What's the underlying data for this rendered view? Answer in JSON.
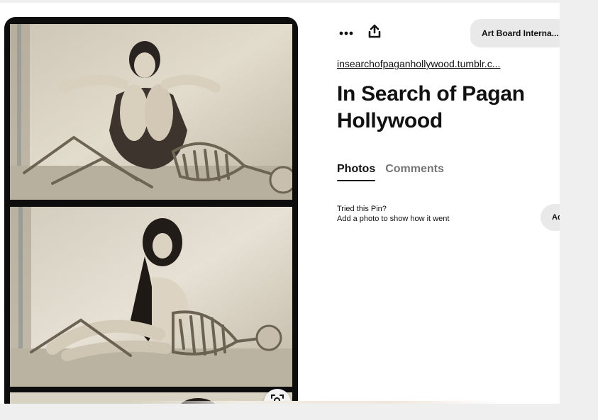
{
  "toolbar": {
    "more_icon": "ellipsis-icon",
    "share_icon": "share-upload-icon",
    "board_select_label": "Art Board Interna..."
  },
  "pin": {
    "source_link": "insearchofpaganhollywood.tumblr.c...",
    "title": "In Search of Pagan Hollywood"
  },
  "tabs": [
    {
      "label": "Photos",
      "active": true
    },
    {
      "label": "Comments",
      "active": false
    }
  ],
  "tried": {
    "line1": "Tried this Pin?",
    "line2": "Add a photo to show how it went",
    "add_button_label": "Ad"
  },
  "image": {
    "visual_search_icon": "visual-search-icon"
  }
}
